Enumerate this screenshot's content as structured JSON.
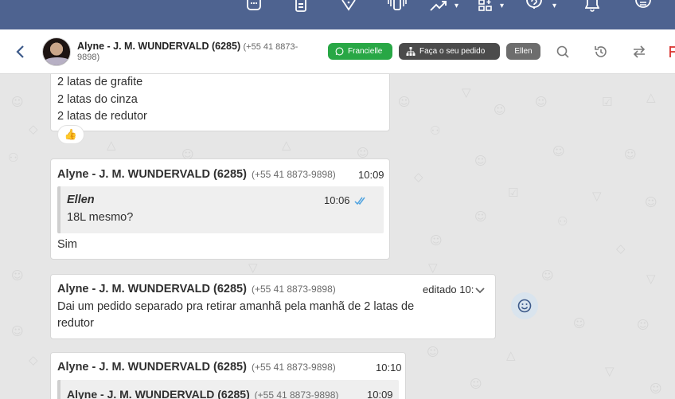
{
  "header": {
    "contact_name": "Alyne - J. M. WUNDERVALD (6285)",
    "contact_phone": "(+55 41 8873-9898)",
    "tag_whatsapp": "Francielle",
    "tag_order": "Faça o seu pedido",
    "tag_agent": "Ellen"
  },
  "colors": {
    "topbar": "#4e6390",
    "whatsapp_green": "#28a745",
    "dark_pill": "#4b4b4b",
    "agent_pill": "#6d6d6d",
    "read_tick": "#4fa3e0"
  },
  "icons": [
    "chat-icon",
    "clipboard-icon",
    "tag-icon",
    "phone-vibrate-icon",
    "trend-icon",
    "apps-icon",
    "help-icon",
    "bell-icon",
    "list-icon",
    "back-icon",
    "search-icon",
    "history-icon",
    "swap-icon",
    "emoji-icon",
    "whatsapp-icon",
    "hierarchy-icon"
  ],
  "messages": [
    {
      "lines": [
        "2 latas de grafite",
        "2 latas do cinza",
        "2 latas de redutor"
      ],
      "reaction": "👍"
    },
    {
      "sender": "Alyne - J. M. WUNDERVALD (6285)",
      "phone": "(+55 41 8873-9898)",
      "time": "10:09",
      "quote_author": "Ellen",
      "quote_time": "10:06",
      "quote_text": "18L mesmo?",
      "text": "Sim"
    },
    {
      "sender": "Alyne - J. M. WUNDERVALD (6285)",
      "phone": "(+55 41 8873-9898)",
      "edited_label": "editado 10:",
      "line1": "Dai um pedido separado pra retirar amanhã pela manhã de 2 latas de",
      "line2": "redutor"
    },
    {
      "sender": "Alyne - J. M. WUNDERVALD (6285)",
      "phone": "(+55 41 8873-9898)",
      "time": "10:10",
      "quote_sender": "Alyne - J. M. WUNDERVALD (6285)",
      "quote_phone": "(+55 41 8873-9898)",
      "quote_time": "10:09"
    }
  ]
}
